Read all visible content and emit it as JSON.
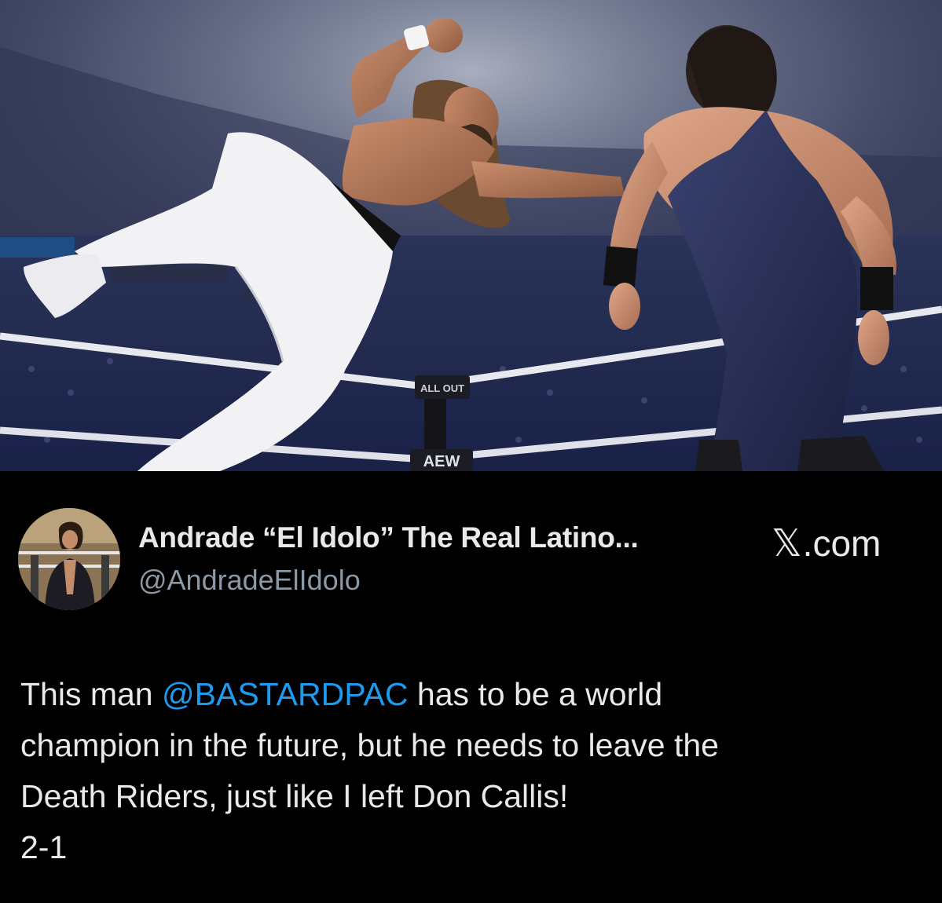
{
  "photo": {
    "alt_theme": "wrestling-match",
    "signage": {
      "ring_post": "ALL OUT",
      "apron_logo": "AEW"
    }
  },
  "author": {
    "display_name": "Andrade “El Idolo” The Real Latino...",
    "handle": "@AndradeElIdolo"
  },
  "brand": {
    "x_glyph": "𝕏",
    "suffix": ".com"
  },
  "tweet": {
    "line1_prefix": "This man ",
    "mention": "@BASTARDPAC",
    "line1_suffix": " has to be a world",
    "line2": "champion in the future, but he needs to leave the",
    "line3": "Death Riders, just like I left Don Callis!",
    "line4": "2-1"
  },
  "colors": {
    "background": "#000000",
    "text_primary": "#e7e9ea",
    "text_secondary": "#8b98a5",
    "link": "#1d9bf0"
  }
}
